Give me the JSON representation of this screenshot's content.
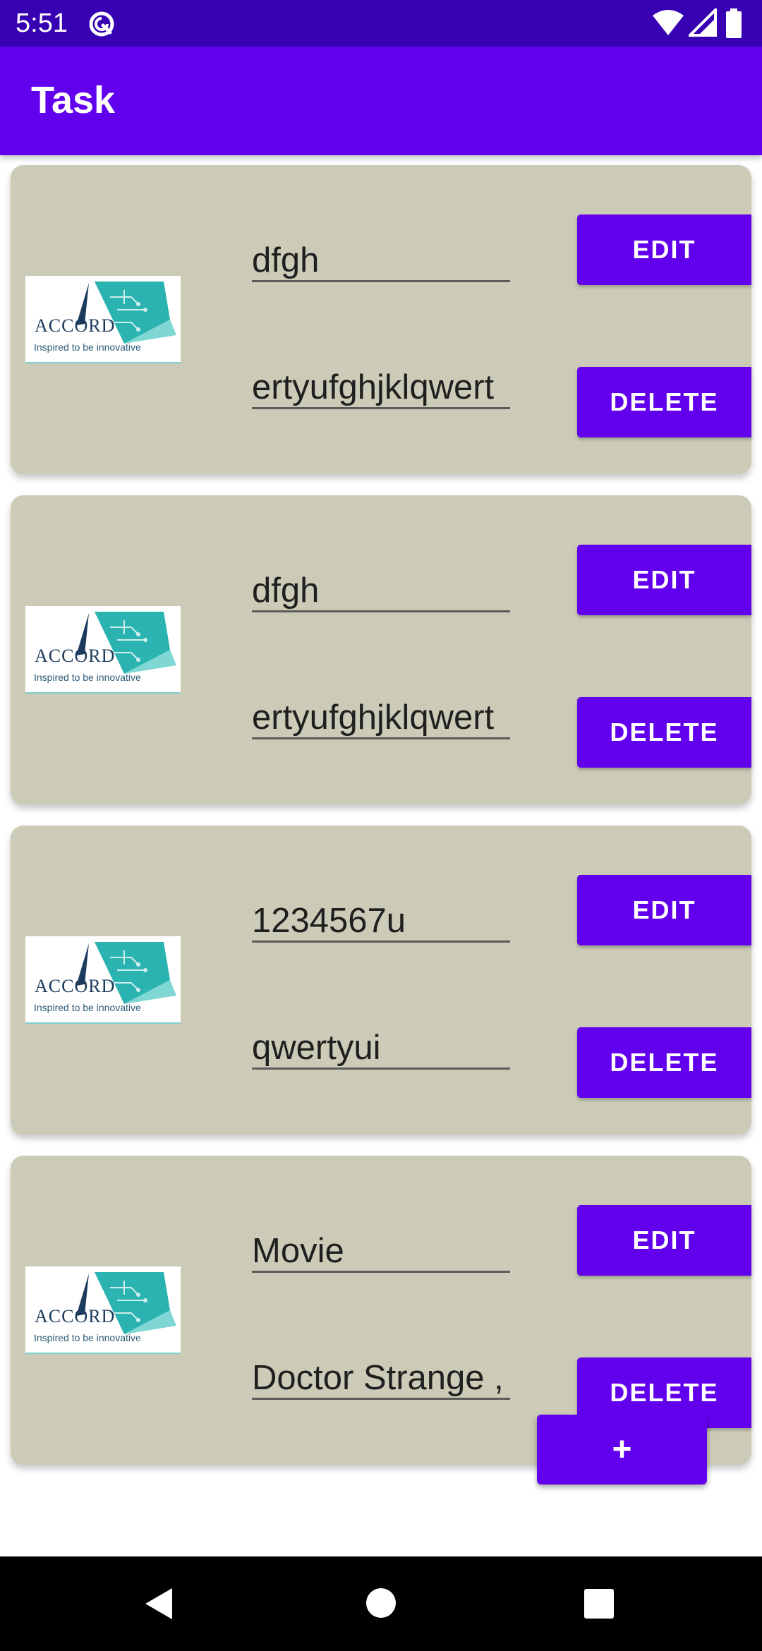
{
  "status_bar": {
    "time": "5:51"
  },
  "app_bar": {
    "title": "Task"
  },
  "logo": {
    "brand": "ACCORD",
    "tagline": "Inspired to be innovative"
  },
  "tasks": [
    {
      "title": "dfgh",
      "description": "ertyufghjklqwert",
      "edit_label": "EDIT",
      "delete_label": "DELETE"
    },
    {
      "title": "dfgh",
      "description": "ertyufghjklqwert",
      "edit_label": "EDIT",
      "delete_label": "DELETE"
    },
    {
      "title": "1234567u",
      "description": "qwertyui",
      "edit_label": "EDIT",
      "delete_label": "DELETE"
    },
    {
      "title": "Movie",
      "description": "Doctor Strange ,",
      "edit_label": "EDIT",
      "delete_label": "DELETE"
    }
  ],
  "fab": {
    "label": "+"
  },
  "icons": {
    "status_app": "at-sign-icon",
    "wifi": "wifi-icon",
    "signal": "signal-icon",
    "battery": "battery-icon",
    "nav_back": "back-triangle-icon",
    "nav_home": "home-circle-icon",
    "nav_recents": "recents-square-icon"
  },
  "colors": {
    "status_bar": "#3700b3",
    "app_bar": "#6200ee",
    "card": "#cccbb7",
    "button": "#6200ee"
  }
}
